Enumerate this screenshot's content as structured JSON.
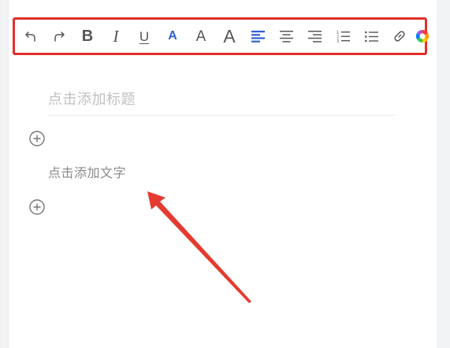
{
  "toolbar": {
    "buttons": [
      {
        "name": "undo-button",
        "icon": "undo-icon"
      },
      {
        "name": "redo-button",
        "icon": "redo-icon"
      },
      {
        "name": "bold-button",
        "icon": "bold-icon",
        "label": "B"
      },
      {
        "name": "italic-button",
        "icon": "italic-icon",
        "label": "I"
      },
      {
        "name": "underline-button",
        "icon": "underline-icon",
        "label": "U"
      },
      {
        "name": "font-color-button",
        "icon": "font-color-icon",
        "label": "A"
      },
      {
        "name": "font-size-medium-button",
        "icon": "font-size-medium-icon",
        "label": "A"
      },
      {
        "name": "font-size-large-button",
        "icon": "font-size-large-icon",
        "label": "A"
      },
      {
        "name": "align-left-button",
        "icon": "align-left-icon"
      },
      {
        "name": "align-center-button",
        "icon": "align-center-icon"
      },
      {
        "name": "align-right-button",
        "icon": "align-right-icon"
      },
      {
        "name": "ordered-list-button",
        "icon": "ordered-list-icon"
      },
      {
        "name": "bullet-list-button",
        "icon": "bullet-list-icon"
      },
      {
        "name": "link-button",
        "icon": "link-icon"
      },
      {
        "name": "color-picker-button",
        "icon": "color-wheel-icon"
      }
    ]
  },
  "editor": {
    "title_placeholder": "点击添加标题",
    "text_placeholder": "点击添加文字"
  },
  "colors": {
    "highlight_border": "#e0302b",
    "active_blue": "#2f5fd0",
    "icon_gray": "#555555",
    "placeholder_gray": "#c0c0c0",
    "arrow_red": "#e53a2f"
  }
}
